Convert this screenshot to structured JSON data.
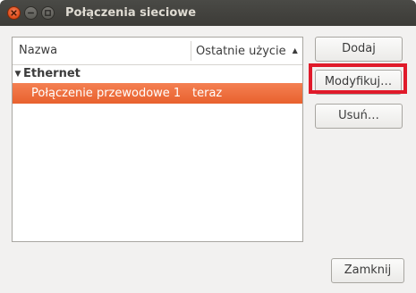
{
  "window": {
    "title": "Połączenia sieciowe",
    "titlebar_color": "#3c3b37",
    "close_button_color": "#df4a16"
  },
  "list": {
    "columns": [
      "Nazwa",
      "Ostatnie użycie"
    ],
    "sort_indicator": "▲",
    "groups": [
      {
        "label": "Ethernet",
        "expander": "▼",
        "connections": [
          {
            "name": "Połączenie przewodowe 1",
            "last_used": "teraz",
            "selected": true
          }
        ]
      }
    ],
    "selection_color": "#e8612e"
  },
  "buttons": {
    "add": "Dodaj",
    "edit": "Modyfikuj…",
    "delete": "Usuń…",
    "close": "Zamknij"
  },
  "highlight": {
    "target": "edit",
    "color": "#e01a2a"
  }
}
